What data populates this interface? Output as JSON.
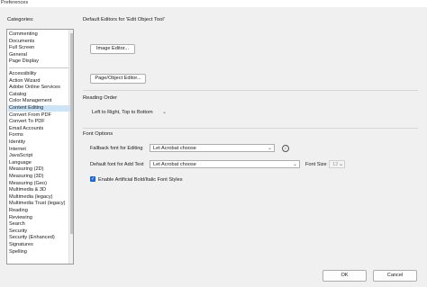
{
  "window": {
    "title": "Preferences"
  },
  "categories": {
    "label": "Categories:",
    "group1": [
      "Commenting",
      "Documents",
      "Full Screen",
      "General",
      "Page Display"
    ],
    "group2": [
      "Accessibility",
      "Action Wizard",
      "Adobe Online Services",
      "Catalog",
      "Color Management",
      "Content Editing",
      "Convert From PDF",
      "Convert To PDF",
      "Email Accounts",
      "Forms",
      "Identity",
      "Internet",
      "JavaScript",
      "Language",
      "Measuring (2D)",
      "Measuring (3D)",
      "Measuring (Geo)",
      "Multimedia & 3D",
      "Multimedia (legacy)",
      "Multimedia Trust (legacy)",
      "Reading",
      "Reviewing",
      "Search",
      "Security",
      "Security (Enhanced)",
      "Signatures",
      "Spelling"
    ],
    "selected": "Content Editing"
  },
  "editors": {
    "heading": "Default Editors for 'Edit Object Tool'",
    "image_button": "Image Editor...",
    "page_object_button": "Page/Object Editor..."
  },
  "reading_order": {
    "heading": "Reading Order",
    "value": "Left to Right, Top to Bottom"
  },
  "font_options": {
    "heading": "Font Options",
    "fallback_label": "Fallback font for Editing",
    "fallback_value": "Let Acrobat choose",
    "default_label": "Default font for Add Text",
    "default_value": "Let Acrobat choose",
    "font_size_label": "Font Size",
    "font_size_value": "12",
    "checkbox_label": "Enable Artificial Bold/Italic Font Styles",
    "checkbox_checked": true
  },
  "footer": {
    "ok": "OK",
    "cancel": "Cancel"
  },
  "colors": {
    "accent": "#1e6fd9",
    "selected_row": "#cce4f7"
  }
}
